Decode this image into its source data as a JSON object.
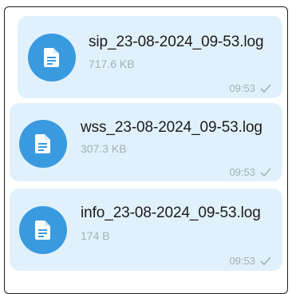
{
  "messages": [
    {
      "file_name": "sip_23-08-2024_09-53.log",
      "file_size": "717.6 KB",
      "time": "09:53",
      "status_icon": "check-icon"
    },
    {
      "file_name": "wss_23-08-2024_09-53.log",
      "file_size": "307.3 KB",
      "time": "09:53",
      "status_icon": "check-icon"
    },
    {
      "file_name": "info_23-08-2024_09-53.log",
      "file_size": "174 B",
      "time": "09:53",
      "status_icon": "check-icon"
    }
  ],
  "colors": {
    "bubble": "#e1f1fb",
    "icon_bg": "#3a9ae0",
    "muted_text": "#a3afb9",
    "primary_text": "#1b1b1b"
  }
}
